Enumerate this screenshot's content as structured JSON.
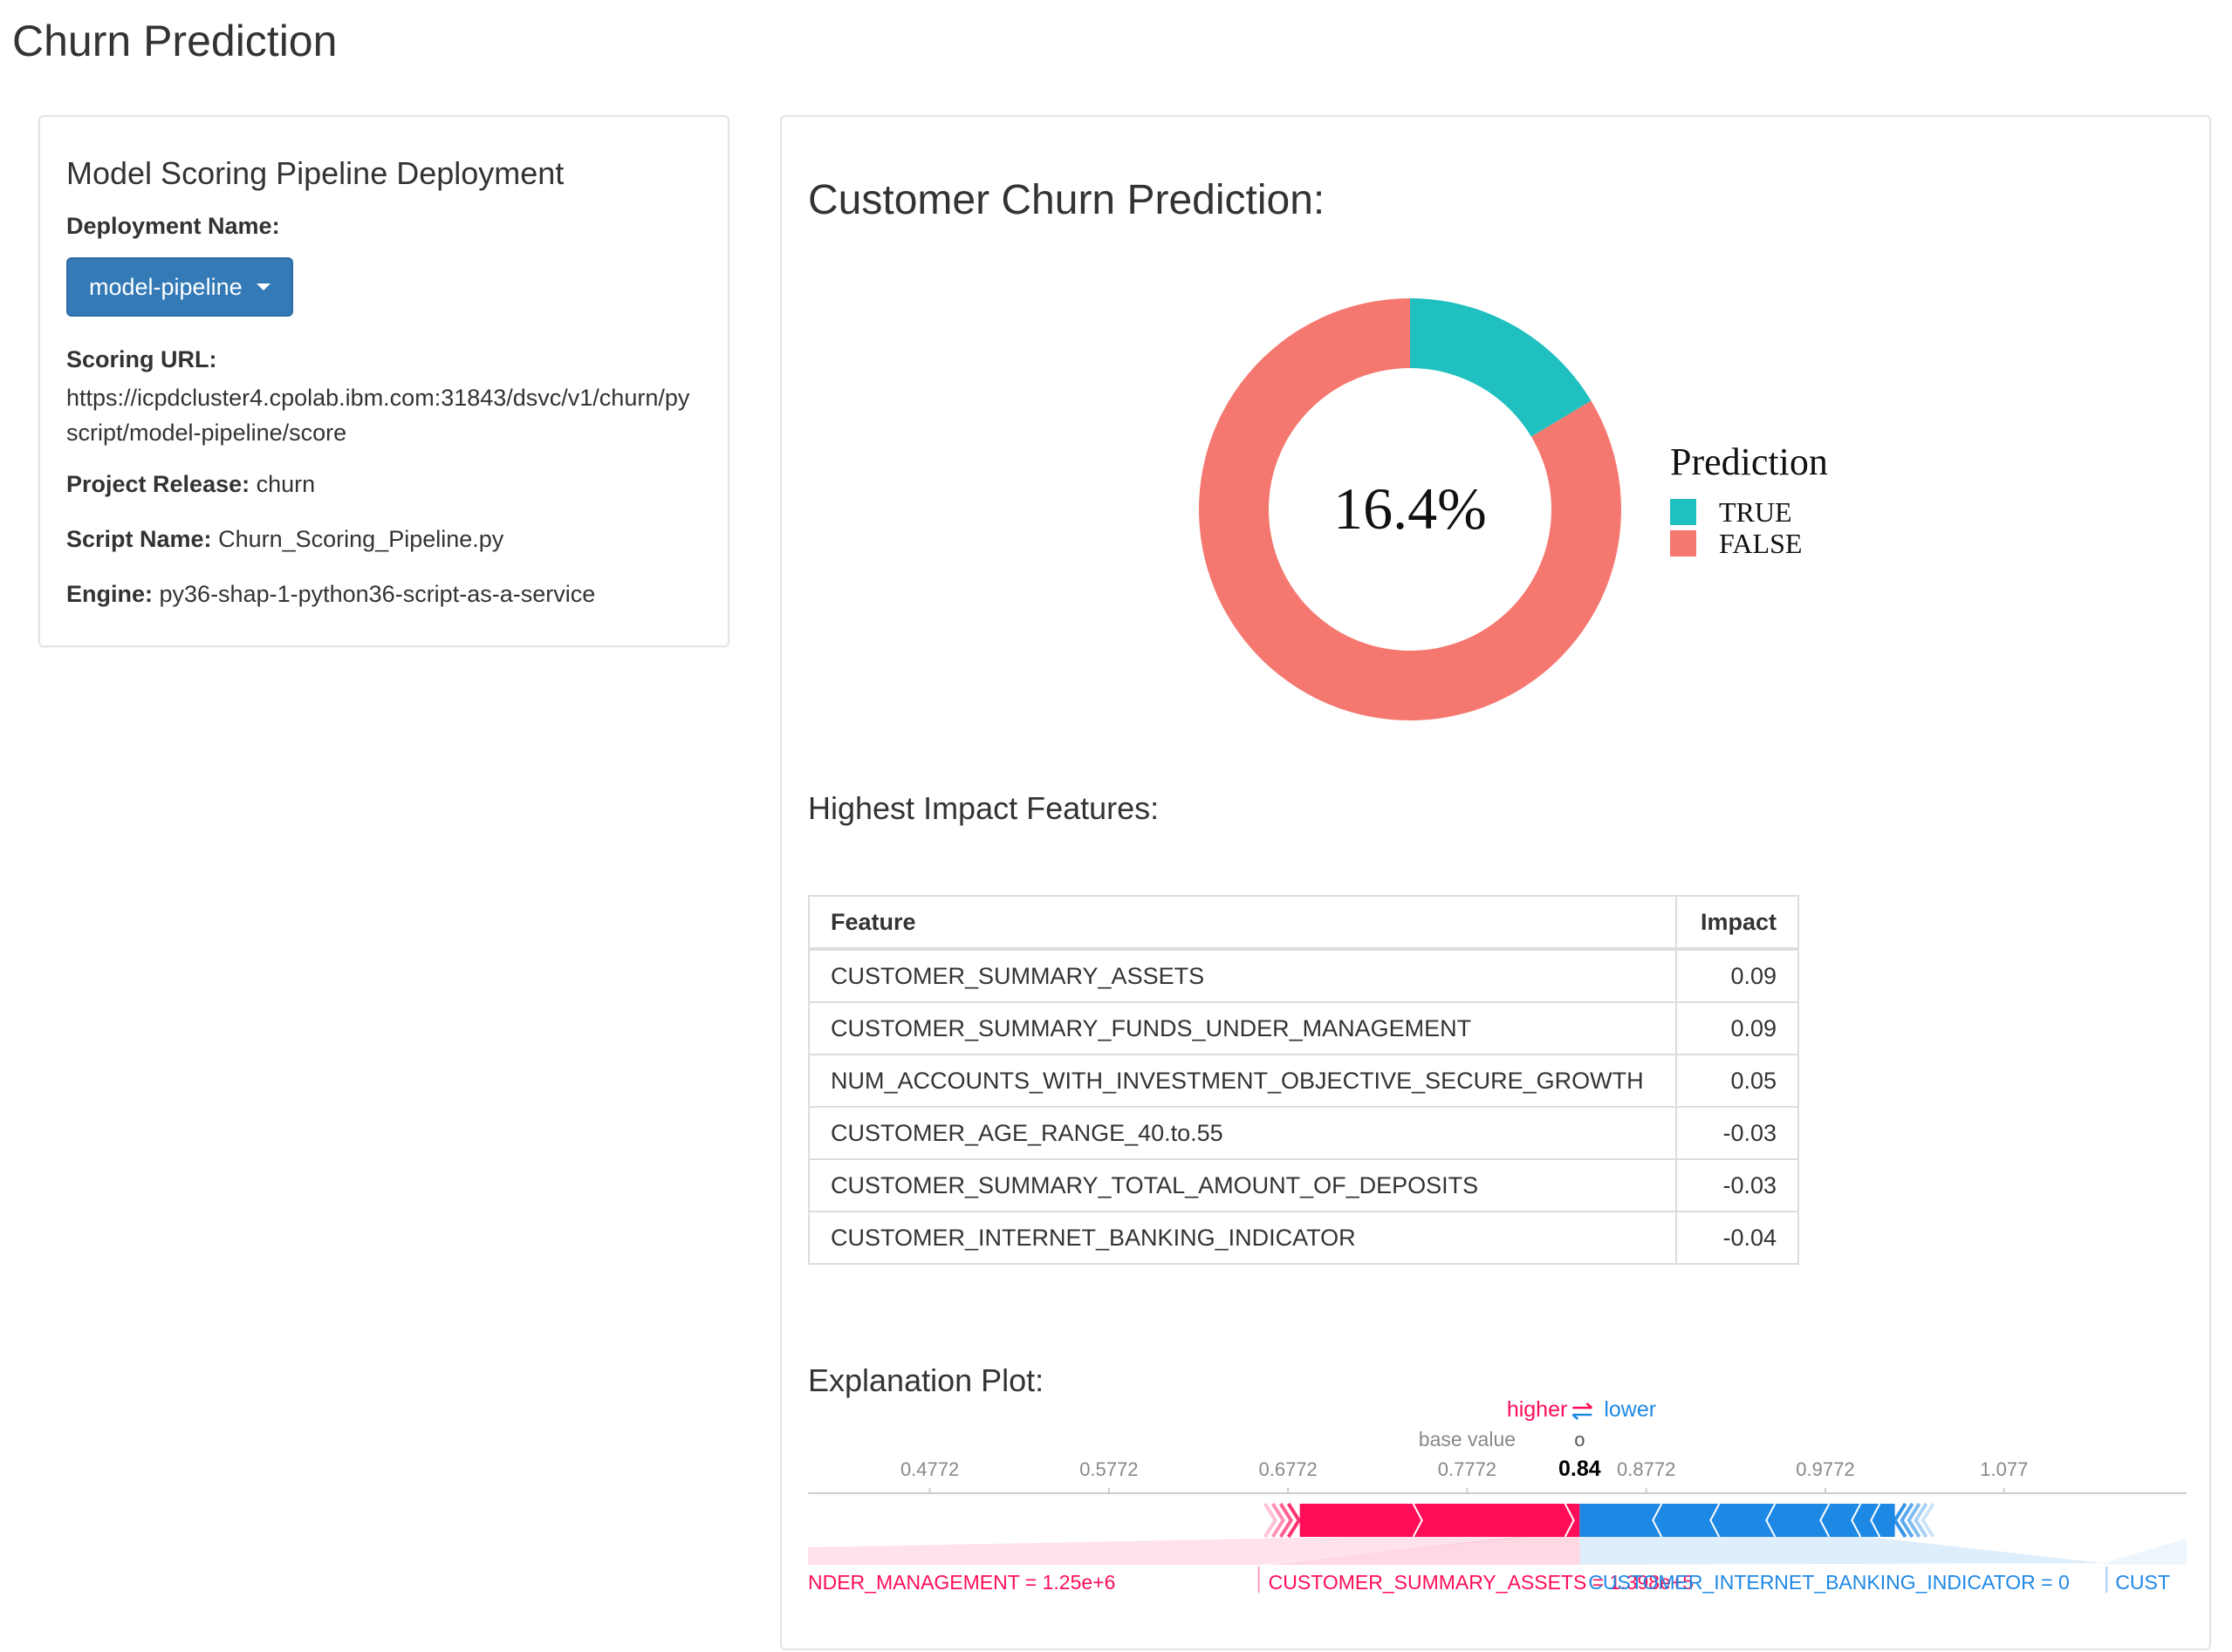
{
  "app": {
    "title": "Churn Prediction"
  },
  "sidebar": {
    "heading": "Model Scoring Pipeline Deployment",
    "deployment_label": "Deployment Name:",
    "deployment_value": "model-pipeline",
    "scoring_url_label": "Scoring URL:",
    "scoring_url": "https://icpdcluster4.cpolab.ibm.com:31843/dsvc/v1/churn/pyscript/model-pipeline/score",
    "release_label": "Project Release:",
    "release_value": "churn",
    "script_label": "Script Name:",
    "script_value": "Churn_Scoring_Pipeline.py",
    "engine_label": "Engine:",
    "engine_value": "py36-shap-1-python36-script-as-a-service"
  },
  "main": {
    "churn_title": "Customer Churn Prediction:",
    "impact_title": "Highest Impact Features:",
    "plot_title": "Explanation Plot:"
  },
  "chart_data": [
    {
      "type": "pie",
      "center_label": "16.4%",
      "legend_title": "Prediction",
      "categories": [
        "TRUE",
        "FALSE"
      ],
      "values": [
        16.4,
        83.6
      ],
      "colors": [
        "#20c0c0",
        "#f57870"
      ],
      "legend_position": "right"
    },
    {
      "type": "table",
      "columns": [
        "Feature",
        "Impact"
      ],
      "rows": [
        [
          "CUSTOMER_SUMMARY_ASSETS",
          "0.09"
        ],
        [
          "CUSTOMER_SUMMARY_FUNDS_UNDER_MANAGEMENT",
          "0.09"
        ],
        [
          "NUM_ACCOUNTS_WITH_INVESTMENT_OBJECTIVE_SECURE_GROWTH",
          "0.05"
        ],
        [
          "CUSTOMER_AGE_RANGE_40.to.55",
          "-0.03"
        ],
        [
          "CUSTOMER_SUMMARY_TOTAL_AMOUNT_OF_DEPOSITS",
          "-0.03"
        ],
        [
          "CUSTOMER_INTERNET_BANKING_INDICATOR",
          "-0.04"
        ]
      ]
    },
    {
      "type": "bar",
      "higher_label": "higher",
      "lower_label": "lower",
      "base_value_label": "base value",
      "output_marker": "o",
      "output_value": 0.84,
      "output_label": "0.84",
      "base_value": 0.7772,
      "ticks": [
        0.4772,
        0.5772,
        0.6772,
        0.7772,
        0.8772,
        0.9772,
        1.077
      ],
      "tick_labels": [
        "0.4772",
        "0.5772",
        "0.6772",
        "0.7772",
        "0.8772",
        "0.9772",
        "1.077"
      ],
      "xlim": [
        0.4092,
        1.1789
      ],
      "positive_range": [
        0.6643,
        0.84
      ],
      "negative_range": [
        0.84,
        1.0355
      ],
      "positive_color": "#ff0d57",
      "negative_color": "#1e88e5",
      "visible_feature_labels": [
        "NDER_MANAGEMENT = 1.25e+6",
        "CUSTOMER_SUMMARY_ASSETS = 1.398e+5",
        "CUSTOMER_INTERNET_BANKING_INDICATOR = 0",
        "CUST"
      ]
    }
  ]
}
